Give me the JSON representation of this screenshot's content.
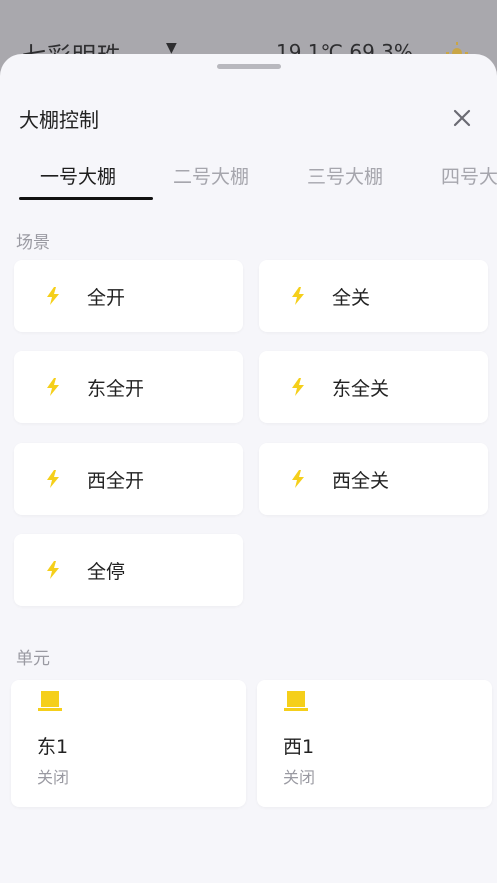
{
  "background": {
    "title": "七彩明珠",
    "weather_text": "19.1℃ 69.3%"
  },
  "sheet": {
    "title": "大棚控制"
  },
  "tabs": [
    {
      "label": "一号大棚"
    },
    {
      "label": "二号大棚"
    },
    {
      "label": "三号大棚"
    },
    {
      "label": "四号大棚"
    }
  ],
  "scenes": {
    "heading": "场景",
    "items": [
      {
        "label": "全开"
      },
      {
        "label": "全关"
      },
      {
        "label": "东全开"
      },
      {
        "label": "东全关"
      },
      {
        "label": "西全开"
      },
      {
        "label": "西全关"
      },
      {
        "label": "全停"
      }
    ]
  },
  "units": {
    "heading": "单元",
    "items": [
      {
        "name": "东1",
        "status": "关闭"
      },
      {
        "name": "西1",
        "status": "关闭"
      }
    ]
  },
  "colors": {
    "accent_yellow": "#f5cf1a",
    "active_tab": "#111111",
    "inactive_tab": "#a6a6ad"
  }
}
